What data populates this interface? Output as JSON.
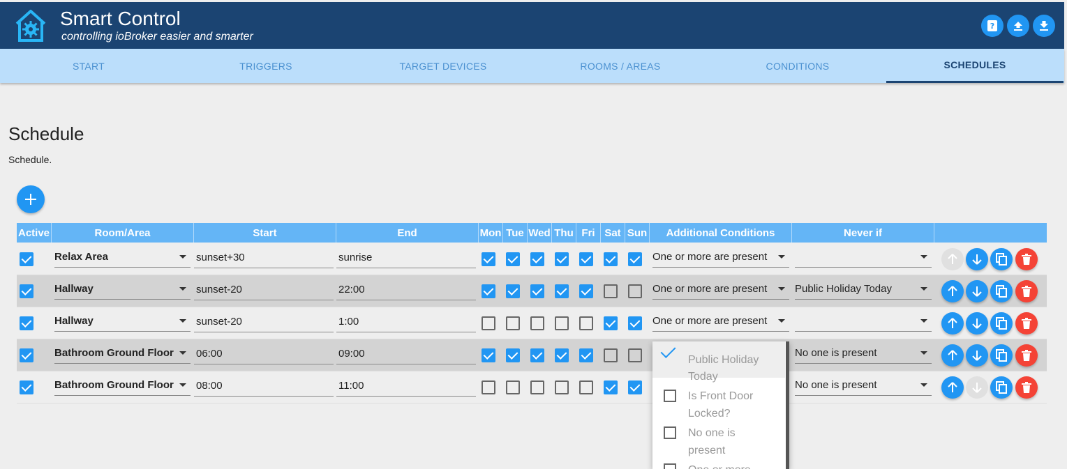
{
  "app": {
    "title": "Smart Control",
    "subtitle": "controlling ioBroker easier and smarter"
  },
  "header_buttons": [
    {
      "icon": "help-book-icon"
    },
    {
      "icon": "upload-icon"
    },
    {
      "icon": "download-icon"
    }
  ],
  "tabs": [
    {
      "label": "START",
      "active": false
    },
    {
      "label": "TRIGGERS",
      "active": false
    },
    {
      "label": "TARGET DEVICES",
      "active": false
    },
    {
      "label": "ROOMS / AREAS",
      "active": false
    },
    {
      "label": "CONDITIONS",
      "active": false
    },
    {
      "label": "SCHEDULES",
      "active": true
    }
  ],
  "page": {
    "title": "Schedule",
    "description": "Schedule."
  },
  "table": {
    "headers": [
      "Active",
      "Room/Area",
      "Start",
      "End",
      "Mon",
      "Tue",
      "Wed",
      "Thu",
      "Fri",
      "Sat",
      "Sun",
      "Additional Conditions",
      "Never if"
    ],
    "rows": [
      {
        "active": true,
        "room": "Relax Area",
        "start": "sunset+30",
        "end": "sunrise",
        "days": [
          true,
          true,
          true,
          true,
          true,
          true,
          true
        ],
        "conditions": "One or more are present",
        "never_if": "",
        "up_enabled": false,
        "down_enabled": true
      },
      {
        "active": true,
        "room": "Hallway",
        "start": "sunset-20",
        "end": "22:00",
        "days": [
          true,
          true,
          true,
          true,
          true,
          false,
          false
        ],
        "conditions": "One or more are present",
        "never_if": "Public Holiday Today",
        "up_enabled": true,
        "down_enabled": true
      },
      {
        "active": true,
        "room": "Hallway",
        "start": "sunset-20",
        "end": "1:00",
        "days": [
          false,
          false,
          false,
          false,
          false,
          true,
          true
        ],
        "conditions": "One or more are present",
        "never_if": "",
        "up_enabled": true,
        "down_enabled": true
      },
      {
        "active": true,
        "room": "Bathroom Ground Floor",
        "start": "06:00",
        "end": "09:00",
        "days": [
          true,
          true,
          true,
          true,
          true,
          false,
          false
        ],
        "conditions": "",
        "never_if": "No one is present",
        "up_enabled": true,
        "down_enabled": true
      },
      {
        "active": true,
        "room": "Bathroom Ground Floor",
        "start": "08:00",
        "end": "11:00",
        "days": [
          false,
          false,
          false,
          false,
          false,
          true,
          true
        ],
        "conditions": "",
        "never_if": "No one is present",
        "up_enabled": true,
        "down_enabled": false
      }
    ]
  },
  "dropdown": {
    "items": [
      {
        "line1": "Public Holiday",
        "line2": "Today",
        "checked": true
      },
      {
        "line1": "Is Front Door",
        "line2": "Locked?",
        "checked": false
      },
      {
        "line1": "No one is",
        "line2": "present",
        "checked": false
      },
      {
        "line1": "One or more",
        "line2": "",
        "checked": false
      }
    ]
  },
  "colors": {
    "header": "#1b4472",
    "tabbar": "#bbdefb",
    "table_header": "#64b5f6",
    "primary": "#2196f3",
    "danger": "#f44336"
  }
}
